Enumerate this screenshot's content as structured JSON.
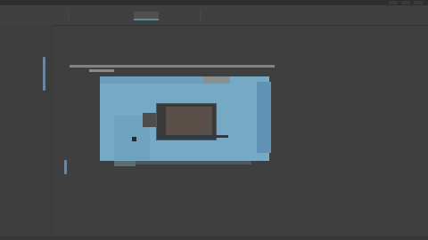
{
  "window": {
    "title": "",
    "controls": [
      "minimize-icon",
      "maximize-icon",
      "close-icon"
    ]
  },
  "menubar": {
    "items": [
      {
        "label": "",
        "active": false
      },
      {
        "label": "",
        "active": false
      },
      {
        "label": "",
        "active": false
      },
      {
        "label": "",
        "active": true
      },
      {
        "label": "",
        "active": false
      }
    ]
  },
  "colors": {
    "canvas": "#76aac4",
    "accent": "#5b8a9a",
    "background": "#3f3f3f"
  }
}
